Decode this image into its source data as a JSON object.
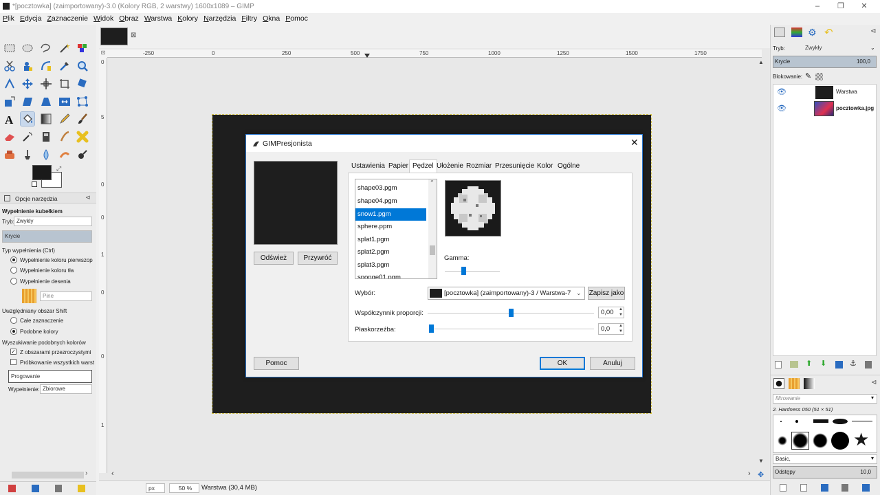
{
  "window": {
    "title": "*[pocztowka] (zaimportowany)-3.0 (Kolory RGB, 2 warstwy) 1600x1089 – GIMP",
    "controls": [
      "–",
      "❐",
      "✕"
    ]
  },
  "menubar": [
    "Plik",
    "Edycja",
    "Zaznaczenie",
    "Widok",
    "Obraz",
    "Warstwa",
    "Kolory",
    "Narzędzia",
    "Filtry",
    "Okna",
    "Pomoc"
  ],
  "tool_options": {
    "tab_label": "Opcje narzędzia",
    "title": "Wypełnienie kubełkiem",
    "mode_label": "Tryb:",
    "mode_value": "Zwykły",
    "opacity_label": "Krycie",
    "fill_type_label": "Typ wypełnienia  (Ctrl)",
    "fill_fg": "Wypełnienie koloru pierwszop",
    "fill_bg": "Wypełnienie koloru tła",
    "fill_pattern": "Wypełnienie desenia",
    "pattern_name": "Pine",
    "area_label": "Uwzględniany obszar  Shift",
    "area_all": "Całe zaznaczenie",
    "area_similar": "Podobne kolory",
    "find_similar_label": "Wyszukiwanie podobnych kolorów",
    "transparent_areas": "Z obszarami przezroczystymi",
    "sample_merged": "Próbkowanie wszystkich warst",
    "threshold_label": "Progowanie",
    "fill_by_label": "Wypełnienie:",
    "fill_by_value": "Zbiorowe"
  },
  "ruler": {
    "h_labels": [
      "-250",
      "0",
      "250",
      "500",
      "750",
      "1000",
      "1250",
      "1500",
      "1750"
    ],
    "v_labels": [
      "0",
      "5",
      "0",
      "0",
      "1",
      "0",
      "0",
      "1"
    ]
  },
  "status": {
    "unit": "px",
    "zoom": "50 %",
    "info": "Warstwa (30,4 MB)"
  },
  "dialog": {
    "title": "GIMPresjonista",
    "refresh": "Odśwież",
    "reset": "Przywróć",
    "help": "Pomoc",
    "ok": "OK",
    "cancel": "Anuluj",
    "tabs": [
      "Ustawienia",
      "Papier",
      "Pędzel",
      "Ułożenie",
      "Rozmiar",
      "Przesunięcie",
      "Kolor",
      "Ogólne"
    ],
    "active_tab": "Pędzel",
    "brushes": [
      "shape03.pgm",
      "shape04.pgm",
      "snow1.pgm",
      "sphere.ppm",
      "splat1.pgm",
      "splat2.pgm",
      "splat3.pgm",
      "sponge01.pgm"
    ],
    "selected_brush": "snow1.pgm",
    "gamma_label": "Gamma:",
    "gamma_value": 0.4,
    "select_label": "Wybór:",
    "select_value": "[pocztowka] (zaimportowany)-3 / Warstwa-7",
    "save_as": "Zapisz jako",
    "aspect_label": "Współczynnik proporcji:",
    "aspect_value": "0,00",
    "aspect_position": 0.5,
    "relief_label": "Płaskorzeźba:",
    "relief_value": "0,0",
    "relief_position": 0.0
  },
  "layers_panel": {
    "mode_label": "Tryb:",
    "mode_value": "Zwykły",
    "opacity_label": "Krycie",
    "opacity_value": "100,0",
    "lock_label": "Blokowanie:",
    "layers": [
      {
        "name": "Warstwa",
        "visible": true
      },
      {
        "name": "pocztowka.jpg",
        "visible": true
      }
    ]
  },
  "brushes_panel": {
    "filter_placeholder": "filtrowanie",
    "current_brush": "2. Hardness 050 (51 × 51)",
    "preset": "Basic,",
    "spacing_label": "Odstępy",
    "spacing_value": "10,0"
  },
  "colors": {
    "accent": "#0078d7",
    "image_bg": "#1e1e1e",
    "selection_dash": "#d4c24a"
  }
}
